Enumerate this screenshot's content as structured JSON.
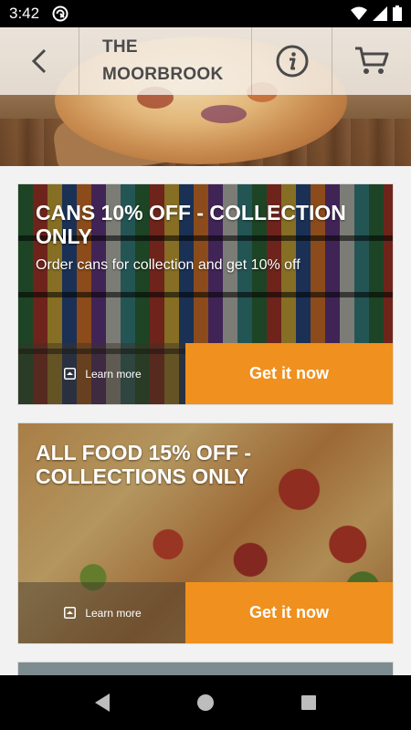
{
  "status_bar": {
    "time": "3:42",
    "icons": [
      "app-notification-icon",
      "wifi-icon",
      "cellular-icon",
      "battery-icon"
    ]
  },
  "header": {
    "title_line1": "THE",
    "title_line2": "MOORBROOK",
    "icons": [
      "back-arrow-icon",
      "info-icon",
      "cart-icon"
    ]
  },
  "offers": [
    {
      "title": "CANS 10% OFF - COLLECTION ONLY",
      "subtitle": "Order cans for collection and get 10% off",
      "learn_more": "Learn more",
      "cta": "Get it now"
    },
    {
      "title": "ALL FOOD 15% OFF - COLLECTIONS ONLY",
      "subtitle": "",
      "learn_more": "Learn more",
      "cta": "Get it now"
    }
  ],
  "nav_bar": {
    "icons": [
      "back-triangle-icon",
      "home-circle-icon",
      "recents-square-icon"
    ]
  },
  "colors": {
    "accent": "#f0901e",
    "status_bar": "#000000",
    "background": "#f2f2f2"
  }
}
